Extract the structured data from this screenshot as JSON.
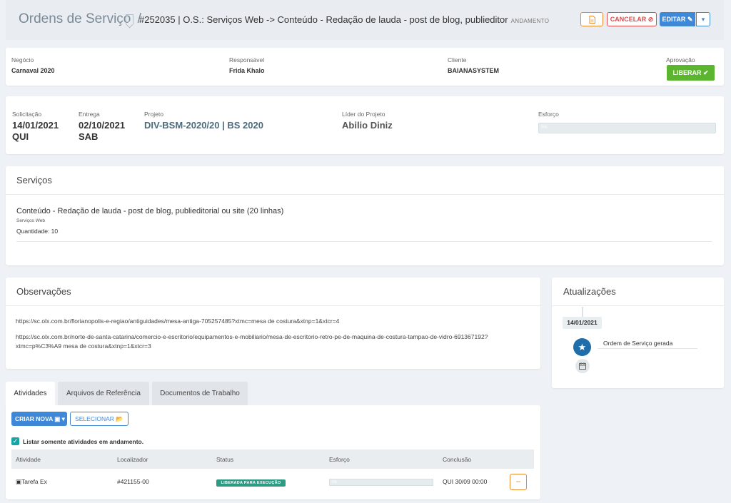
{
  "header": {
    "title": "Ordens de Serviço",
    "slash": "/",
    "os_title": "#252035 | O.S.: Serviços Web -> Conteúdo - Redação de lauda - post de blog, publieditor",
    "os_status": "ANDAMENTO",
    "cancel_label": "CANCELAR",
    "edit_label": "EDITAR"
  },
  "info": {
    "negocio_label": "Negócio",
    "negocio_value": "Carnaval 2020",
    "responsavel_label": "Responsável",
    "responsavel_value": "Frida Khalo",
    "cliente_label": "Cliente",
    "cliente_value": "BAIANASYSTEM",
    "aprovacao_label": "Aprovação",
    "liberar_label": "LIBERAR"
  },
  "details": {
    "solicitacao_label": "Solicitação",
    "solicitacao_date": "14/01/2021",
    "solicitacao_day": "QUI",
    "entrega_label": "Entrega",
    "entrega_date": "02/10/2021",
    "entrega_day": "SAB",
    "projeto_label": "Projeto",
    "projeto_value": "DIV-BSM-2020/20 | BS 2020",
    "lider_label": "Líder do Projeto",
    "lider_value": "Abilio Diniz",
    "esforco_label": "Esforço",
    "esforco_value": "0%"
  },
  "servicos": {
    "title": "Serviços",
    "item_name": "Conteúdo - Redação de lauda - post de blog, publieditorial ou site (20 linhas)",
    "item_category": "Serviços Web",
    "item_quantity": "Quantidade: 10"
  },
  "observacoes": {
    "title": "Observações",
    "line1": "https://sc.olx.com.br/florianopolis-e-regiao/antiguidades/mesa-antiga-705257485?xtmc=mesa de costura&xtnp=1&xtcr=4",
    "line2": "https://sc.olx.com.br/norte-de-santa-catarina/comercio-e-escritorio/equipamentos-e-mobiliario/mesa-de-escritorio-retro-pe-de-maquina-de-costura-tampao-de-vidro-691367192?",
    "line3": "xtmc=p%C3%A9 mesa de costura&xtnp=1&xtcr=3"
  },
  "atualizacoes": {
    "title": "Atualizações",
    "date": "14/01/2021",
    "event": "Ordem de Serviço gerada"
  },
  "tabs": {
    "atividades": "Atividades",
    "arquivos": "Arquivos de Referência",
    "documentos": "Documentos de Trabalho"
  },
  "activities": {
    "criar_label": "CRIAR NOVA",
    "selecionar_label": "SELECIONAR",
    "filter_label": "Listar somente atividades em andamento.",
    "columns": {
      "atividade": "Atividade",
      "localizador": "Localizador",
      "status": "Status",
      "esforco": "Esforço",
      "conclusao": "Conclusão"
    },
    "rows": [
      {
        "atividade": "Tarefa Ex",
        "localizador": "#421155-00",
        "status": "LIBERADA PARA EXECUÇÃO",
        "esforco": "0%",
        "conclusao": "QUI 30/09 00:00"
      }
    ]
  },
  "colors": {
    "primary": "#3f88d7",
    "success": "#5cb52e",
    "danger": "#e04b4b",
    "warning": "#e88c2f",
    "teal": "#2b9b84"
  }
}
